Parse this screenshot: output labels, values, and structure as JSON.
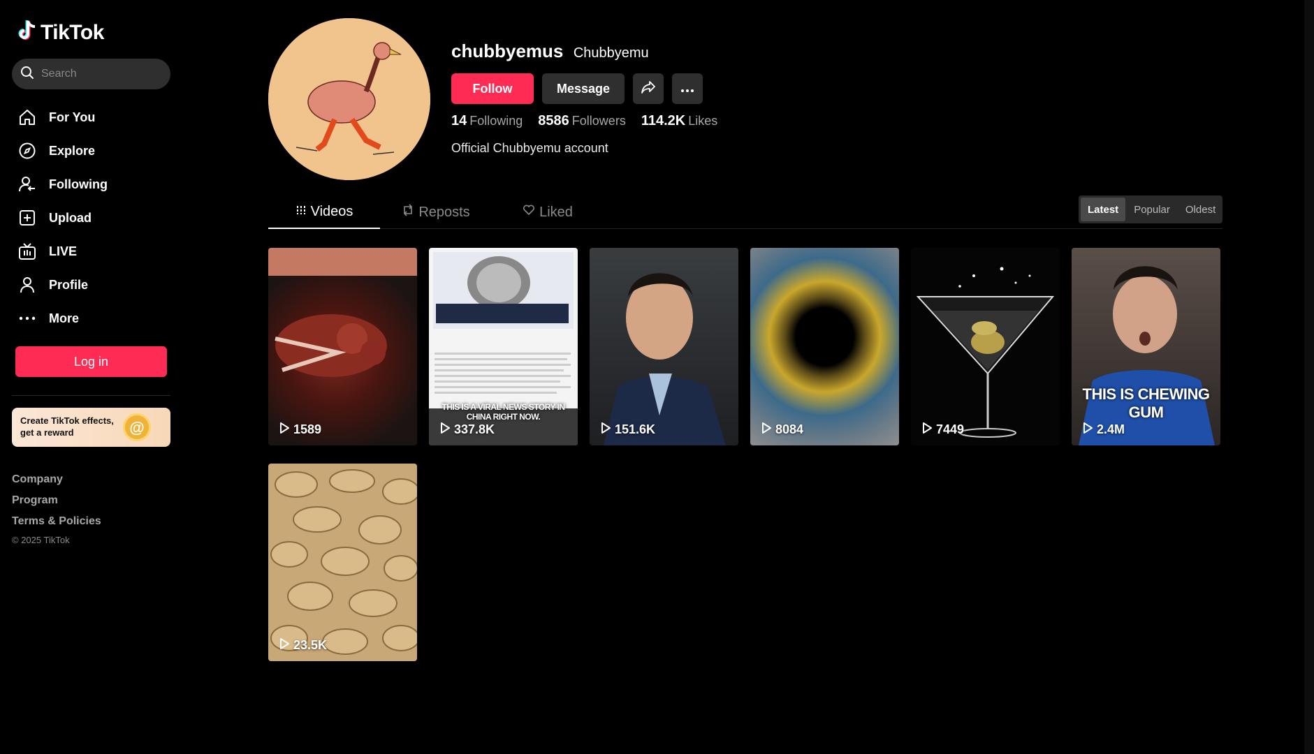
{
  "sidebar": {
    "logo": "TikTok",
    "search_placeholder": "Search",
    "nav": [
      {
        "label": "For You",
        "icon": "home-icon"
      },
      {
        "label": "Explore",
        "icon": "compass-icon"
      },
      {
        "label": "Following",
        "icon": "following-icon"
      },
      {
        "label": "Upload",
        "icon": "upload-icon"
      },
      {
        "label": "LIVE",
        "icon": "live-icon"
      },
      {
        "label": "Profile",
        "icon": "profile-icon"
      },
      {
        "label": "More",
        "icon": "more-icon"
      }
    ],
    "login_label": "Log in",
    "effects_banner": {
      "line1": "Create TikTok effects,",
      "line2": "get a reward"
    },
    "footer": {
      "links": [
        "Company",
        "Program",
        "Terms & Policies"
      ],
      "copyright": "© 2025 TikTok"
    }
  },
  "profile": {
    "username": "chubbyemus",
    "nickname": "Chubbyemu",
    "follow_label": "Follow",
    "message_label": "Message",
    "stats": {
      "following": {
        "value": "14",
        "label": "Following"
      },
      "followers": {
        "value": "8586",
        "label": "Followers"
      },
      "likes": {
        "value": "114.2K",
        "label": "Likes"
      }
    },
    "bio": "Official Chubbyemu account"
  },
  "tabs": [
    {
      "label": "Videos",
      "active": true
    },
    {
      "label": "Reposts",
      "active": false
    },
    {
      "label": "Liked",
      "active": false
    }
  ],
  "sort": {
    "options": [
      "Latest",
      "Popular",
      "Oldest"
    ],
    "selected": "Latest"
  },
  "videos": [
    {
      "views": "1589"
    },
    {
      "views": "337.8K",
      "overlay": "THIS IS A VIRAL NEWS STORY IN CHINA RIGHT NOW."
    },
    {
      "views": "151.6K"
    },
    {
      "views": "8084"
    },
    {
      "views": "7449"
    },
    {
      "views": "2.4M",
      "overlay": "THIS IS CHEWING GUM"
    },
    {
      "views": "23.5K"
    }
  ],
  "colors": {
    "accent": "#fe2c55",
    "background": "#000000",
    "surface": "#2f2f2f"
  }
}
